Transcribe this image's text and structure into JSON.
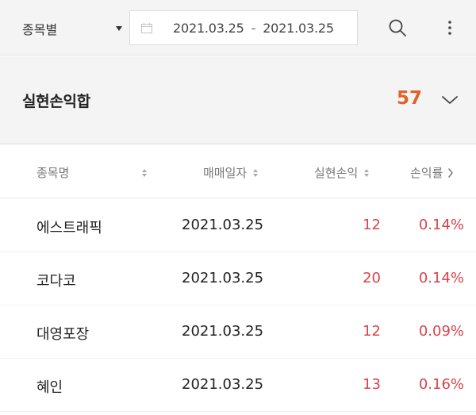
{
  "toolbar": {
    "filter_label": "종목별",
    "date_start": "2021.03.25",
    "date_separator": "-",
    "date_end": "2021.03.25"
  },
  "summary": {
    "label": "실현손익합",
    "value": "57"
  },
  "table": {
    "headers": [
      "종목명",
      "매매일자",
      "실현손익",
      "손익률"
    ],
    "rows": [
      {
        "name": "에스트래픽",
        "date": "2021.03.25",
        "pnl": "12",
        "rate": "0.14%"
      },
      {
        "name": "코다코",
        "date": "2021.03.25",
        "pnl": "20",
        "rate": "0.14%"
      },
      {
        "name": "대영포장",
        "date": "2021.03.25",
        "pnl": "12",
        "rate": "0.09%"
      },
      {
        "name": "혜인",
        "date": "2021.03.25",
        "pnl": "13",
        "rate": "0.16%"
      }
    ]
  },
  "colors": {
    "summary_value": "#e0612a",
    "profit_red": "#d9434b",
    "panel_bg": "#f4f4f5"
  },
  "icons": {
    "date": "calendar-icon",
    "search": "search-icon",
    "more": "more-vertical-icon",
    "toggle": "chevron-down-icon",
    "sort": "sort-icon",
    "next": "chevron-right-icon"
  }
}
